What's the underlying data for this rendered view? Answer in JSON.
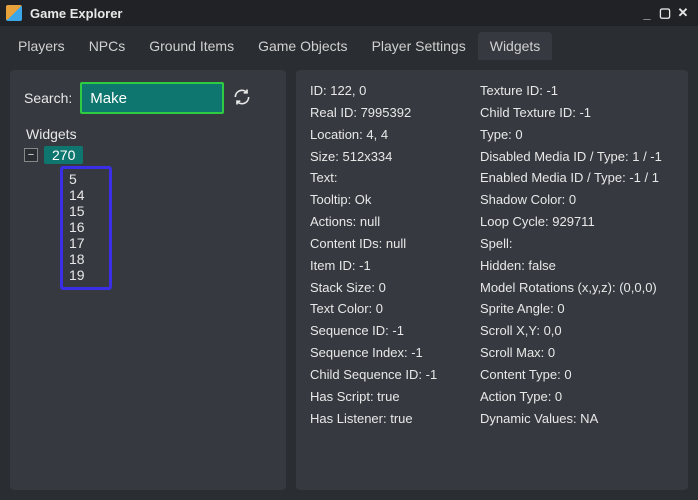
{
  "window_title": "Game Explorer",
  "tabs": [
    {
      "label": "Players"
    },
    {
      "label": "NPCs"
    },
    {
      "label": "Ground Items"
    },
    {
      "label": "Game Objects"
    },
    {
      "label": "Player Settings"
    },
    {
      "label": "Widgets",
      "active": true
    }
  ],
  "search": {
    "label": "Search:",
    "value": "Make"
  },
  "tree": {
    "header": "Widgets",
    "toggle_glyph": "−",
    "parent": "270",
    "children": [
      "5",
      "14",
      "15",
      "16",
      "17",
      "18",
      "19"
    ]
  },
  "details_left": [
    "ID: 122, 0",
    "Real ID: 7995392",
    "Location: 4, 4",
    "Size: 512x334",
    "Text:",
    "Tooltip: Ok",
    "Actions: null",
    "Content IDs: null",
    "Item ID: -1",
    "Stack Size: 0",
    "Text Color: 0",
    "Sequence ID: -1",
    "Sequence Index: -1",
    "Child Sequence ID: -1",
    "Has Script: true",
    "Has Listener: true"
  ],
  "details_right": [
    "Texture ID: -1",
    "Child Texture ID: -1",
    "Type: 0",
    "Disabled Media ID / Type: 1 / -1",
    "Enabled Media ID / Type: -1 / 1",
    "Shadow Color: 0",
    "Loop Cycle: 929711",
    "Spell:",
    "Hidden: false",
    "Model Rotations (x,y,z): (0,0,0)",
    "Sprite Angle: 0",
    "Scroll X,Y: 0,0",
    "Scroll Max: 0",
    "Content Type: 0",
    "Action Type: 0",
    "Dynamic Values: NA"
  ]
}
